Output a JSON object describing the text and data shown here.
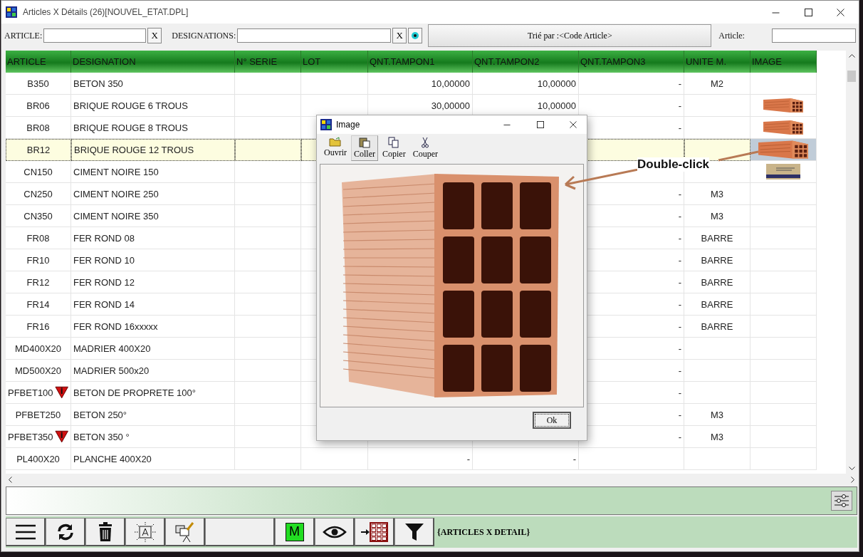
{
  "window": {
    "title": "Articles X Détails (26)[NOUVEL_ETAT.DPL]"
  },
  "toolbar": {
    "article": {
      "label": "ARTICLE:",
      "clear": "X"
    },
    "designations": {
      "label": "DESIGNATIONS:",
      "clear": "X"
    },
    "sort_button": "Trié par :<Code Article>",
    "article_search": {
      "label": "Article:"
    }
  },
  "table": {
    "columns": [
      "ARTICLE",
      "DESIGNATION",
      "N° SERIE",
      "LOT",
      "QNT.TAMPON1",
      "QNT.TAMPON2",
      "QNT.TAMPON3",
      "UNITE M.",
      "IMAGE"
    ],
    "rows": [
      {
        "article": "B350",
        "warning": false,
        "designation": "BETON 350",
        "qnt1": "10,00000",
        "qnt2": "10,00000",
        "qnt3": "-",
        "unit": "M2",
        "selected": false
      },
      {
        "article": "BR06",
        "warning": false,
        "designation": "BRIQUE ROUGE 6 TROUS",
        "qnt1": "30,00000",
        "qnt2": "10,00000",
        "qnt3": "-",
        "image": {
          "kind": "brick"
        },
        "selected": false
      },
      {
        "article": "BR08",
        "warning": false,
        "designation": "BRIQUE ROUGE 8 TROUS",
        "qnt3": "-",
        "image": {
          "kind": "brick"
        },
        "selected": false
      },
      {
        "article": "BR12",
        "warning": false,
        "designation": "BRIQUE ROUGE 12 TROUS",
        "image": {
          "kind": "brick"
        },
        "selected": true
      },
      {
        "article": "CN150",
        "warning": false,
        "designation": "CIMENT NOIRE 150",
        "image": {
          "kind": "bag"
        },
        "selected": false
      },
      {
        "article": "CN250",
        "warning": false,
        "designation": "CIMENT NOIRE 250",
        "qnt3": "-",
        "unit": "M3",
        "selected": false
      },
      {
        "article": "CN350",
        "warning": false,
        "designation": "CIMENT NOIRE 350",
        "qnt3": "-",
        "unit": "M3",
        "selected": false
      },
      {
        "article": "FR08",
        "warning": false,
        "designation": "FER ROND 08",
        "qnt3": "-",
        "unit": "BARRE",
        "selected": false
      },
      {
        "article": "FR10",
        "warning": false,
        "designation": "FER ROND 10",
        "qnt3": "-",
        "unit": "BARRE",
        "selected": false
      },
      {
        "article": "FR12",
        "warning": false,
        "designation": "FER ROND 12",
        "qnt3": "-",
        "unit": "BARRE",
        "selected": false
      },
      {
        "article": "FR14",
        "warning": false,
        "designation": "FER ROND 14",
        "qnt3": "-",
        "unit": "BARRE",
        "selected": false
      },
      {
        "article": "FR16",
        "warning": false,
        "designation": "FER ROND 16xxxxx",
        "qnt3": "-",
        "unit": "BARRE",
        "selected": false
      },
      {
        "article": "MD400X20",
        "warning": false,
        "designation": "MADRIER 400X20",
        "qnt3": "-",
        "selected": false
      },
      {
        "article": "MD500X20",
        "warning": false,
        "designation": "MADRIER 500x20",
        "qnt3": "-",
        "selected": false
      },
      {
        "article": "PFBET100",
        "warning": true,
        "designation": "BETON DE PROPRETE 100°",
        "qnt3": "-",
        "selected": false
      },
      {
        "article": "PFBET250",
        "warning": false,
        "designation": "BETON 250°",
        "qnt3": "-",
        "unit": "M3",
        "selected": false
      },
      {
        "article": "PFBET350",
        "warning": true,
        "designation": "BETON 350 °",
        "qnt3": "-",
        "unit": "M3",
        "selected": false
      },
      {
        "article": "PL400X20",
        "warning": false,
        "designation": "PLANCHE 400X20",
        "qnt1": "-",
        "qnt2": "-",
        "selected": false
      }
    ]
  },
  "dialog": {
    "title": "Image",
    "tools": [
      {
        "kind": "open",
        "label": "Ouvrir",
        "selected": false
      },
      {
        "kind": "paste",
        "label": "Coller",
        "selected": true
      },
      {
        "kind": "copy",
        "label": "Copier",
        "selected": false
      },
      {
        "kind": "cut",
        "label": "Couper",
        "selected": false
      }
    ],
    "ok": "Ok"
  },
  "annotation": {
    "text": "Double-click"
  },
  "bottom_toolbar": {
    "buttons": [
      {
        "kind": "menu"
      },
      {
        "kind": "refresh"
      },
      {
        "kind": "trash"
      },
      {
        "kind": "text-frame"
      },
      {
        "kind": "edit"
      },
      {
        "kind": "blank"
      },
      {
        "kind": "letter",
        "label": "M"
      },
      {
        "kind": "eye"
      },
      {
        "kind": "insert-grid"
      },
      {
        "kind": "filter"
      }
    ],
    "status": "{ARTICLES X DETAIL}"
  }
}
